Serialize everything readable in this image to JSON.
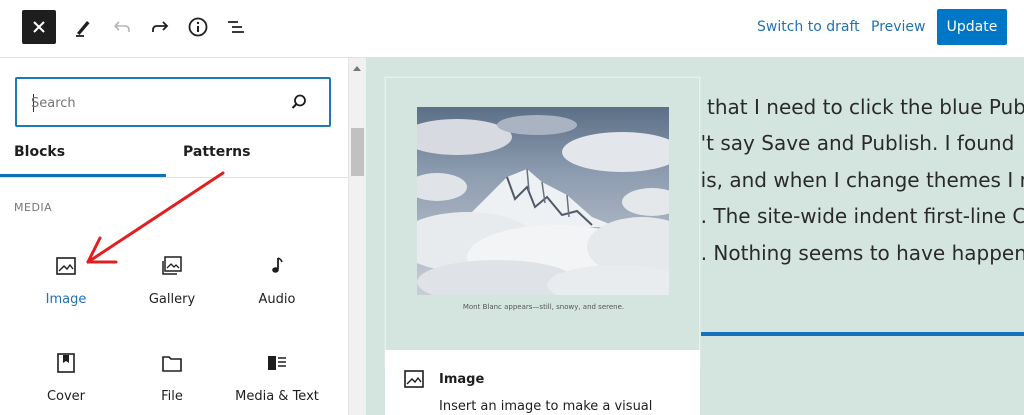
{
  "toolbar": {
    "switch_draft_label": "Switch to draft",
    "preview_label": "Preview",
    "update_label": "Update"
  },
  "inserter": {
    "search": {
      "placeholder": "Search",
      "value": ""
    },
    "tabs": [
      {
        "label": "Blocks",
        "active": true
      },
      {
        "label": "Patterns",
        "active": false
      }
    ],
    "category": "MEDIA",
    "blocks": [
      {
        "label": "Image",
        "icon": "image-icon",
        "active": true
      },
      {
        "label": "Gallery",
        "icon": "gallery-icon",
        "active": false
      },
      {
        "label": "Audio",
        "icon": "audio-icon",
        "active": false
      },
      {
        "label": "Cover",
        "icon": "cover-icon",
        "active": false
      },
      {
        "label": "File",
        "icon": "file-icon",
        "active": false
      },
      {
        "label": "Media & Text",
        "icon": "media-text-icon",
        "active": false
      }
    ]
  },
  "preview": {
    "caption": "Mont Blanc appears—still, snowy, and serene.",
    "title": "Image",
    "description": "Insert an image to make a visual"
  },
  "content": {
    "lines": [
      "n that I need to click the blue Publis",
      "n't say Save and Publish. I found",
      "his, and when I change themes I ma",
      "n. The site-wide indent first-line CSS",
      "d. Nothing seems to have happened"
    ]
  },
  "colors": {
    "accent": "#0077c6",
    "canvas_bg": "#d4e5e0",
    "annotation_arrow": "#e02020"
  }
}
